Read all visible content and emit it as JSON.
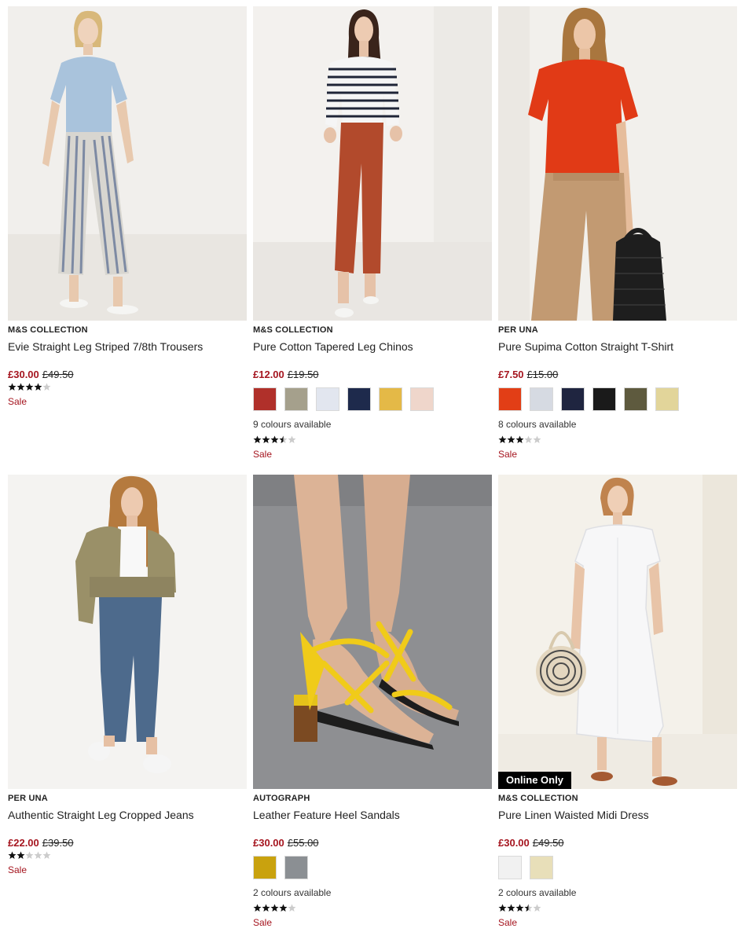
{
  "products": [
    {
      "brand": "M&S COLLECTION",
      "title": "Evie Straight Leg Striped 7/8th Trousers",
      "price_now": "£30.00",
      "price_was": "£49.50",
      "swatches": [],
      "colours_text": "",
      "rating": 4,
      "sale": "Sale",
      "badge": "",
      "image": "woman-blue-tshirt-striped-trousers"
    },
    {
      "brand": "M&S COLLECTION",
      "title": "Pure Cotton Tapered Leg Chinos",
      "price_now": "£12.00",
      "price_was": "£19.50",
      "swatches": [
        "#b0302a",
        "#a5a08c",
        "#e2e6ef",
        "#1e2a4c",
        "#e4b947",
        "#efd6cb"
      ],
      "colours_text": "9 colours available",
      "rating": 3.5,
      "sale": "Sale",
      "badge": "",
      "image": "woman-striped-top-red-chinos"
    },
    {
      "brand": "PER UNA",
      "title": "Pure Supima Cotton Straight T-Shirt",
      "price_now": "£7.50",
      "price_was": "£15.00",
      "swatches": [
        "#e23e16",
        "#d6dae2",
        "#1f2540",
        "#1a1a1a",
        "#5e5a3e",
        "#e2d59a"
      ],
      "colours_text": "8 colours available",
      "rating": 3,
      "sale": "Sale",
      "badge": "",
      "image": "woman-red-tshirt-tan-trousers"
    },
    {
      "brand": "PER UNA",
      "title": "Authentic Straight Leg Cropped Jeans",
      "price_now": "£22.00",
      "price_was": "£39.50",
      "swatches": [],
      "colours_text": "",
      "rating": 2,
      "sale": "Sale",
      "badge": "",
      "image": "woman-khaki-jacket-cropped-jeans"
    },
    {
      "brand": "AUTOGRAPH",
      "title": "Leather Feature Heel Sandals",
      "price_now": "£30.00",
      "price_was": "£55.00",
      "swatches": [
        "#c9a20e",
        "#8b8f93"
      ],
      "colours_text": "2 colours available",
      "rating": 4,
      "sale": "Sale",
      "badge": "",
      "image": "yellow-strappy-heel-sandals"
    },
    {
      "brand": "M&S COLLECTION",
      "title": "Pure Linen Waisted Midi Dress",
      "price_now": "£30.00",
      "price_was": "£49.50",
      "swatches": [
        "#f1f1f1",
        "#e8dfb9"
      ],
      "colours_text": "2 colours available",
      "rating": 3.5,
      "sale": "Sale",
      "badge": "Online Only",
      "image": "woman-white-linen-midi-dress"
    }
  ],
  "colors": {
    "sale_red": "#a5151f",
    "star_filled": "#111111",
    "star_empty": "#cccccc",
    "badge_bg": "#000000"
  }
}
